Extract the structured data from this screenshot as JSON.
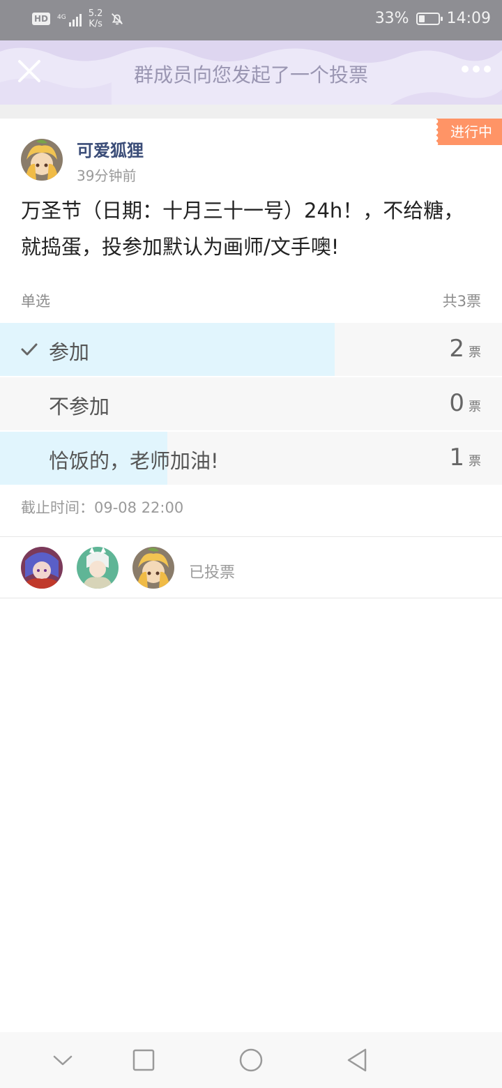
{
  "status_bar": {
    "hd_label": "HD",
    "network_label": "4G",
    "speed_value": "5.2",
    "speed_unit": "K/s",
    "battery_percent": "33%",
    "battery_level": 0.33,
    "time": "14:09"
  },
  "header": {
    "title": "群成员向您发起了一个投票",
    "close_icon": "close-icon",
    "more_icon": "more-dots-icon"
  },
  "poll": {
    "status_tag": "进行中",
    "author_name": "可爱狐狸",
    "post_time": "39分钟前",
    "question": "万圣节（日期：十月三十一号）24h！，不给糖，就捣蛋，投参加默认为画师/文手噢!",
    "type_label": "单选",
    "total_label": "共3票",
    "vote_unit": "票",
    "options": [
      {
        "label": "参加",
        "votes": "2",
        "share": 0.667,
        "selected": true
      },
      {
        "label": "不参加",
        "votes": "0",
        "share": 0,
        "selected": false
      },
      {
        "label": "恰饭的，老师加油!",
        "votes": "1",
        "share": 0.333,
        "selected": false
      }
    ],
    "deadline": "截止时间：09-08 22:00",
    "voted_label": "已投票"
  },
  "colors": {
    "accent_bar": "#e1f5fd",
    "status_tag": "#ff9466",
    "author_name": "#3b4d78",
    "header_bg": "#e9e4f6"
  },
  "nav": {
    "icons": [
      "chevron-down-icon",
      "square-icon",
      "circle-icon",
      "back-triangle-icon"
    ]
  }
}
